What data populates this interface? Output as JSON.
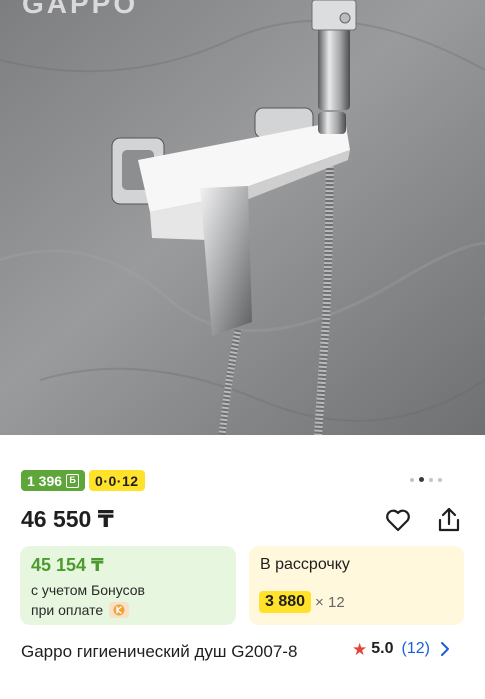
{
  "product": {
    "brand_watermark": "GAPPO",
    "bonus_badge": "1 396",
    "installment_badge": "0·0·12",
    "price": "46 550 ₸",
    "bonus_card": {
      "amount": "45 154 ₸",
      "line1": "с учетом Бонусов",
      "line2": "при оплате"
    },
    "installment_card": {
      "title": "В рассрочку",
      "amount": "3 880",
      "multiplier": "× 12"
    },
    "title": "Gappo гигиенический душ G2007-8",
    "rating": {
      "score": "5.0",
      "count": "(12)"
    }
  },
  "gallery": {
    "total": 4,
    "active": 2
  },
  "colors": {
    "bonus_green": "#5ea63a",
    "installment_yellow": "#ffe229",
    "star_red": "#e4453a",
    "link_blue": "#1b5fd6"
  },
  "icons": [
    "heart-icon",
    "share-icon",
    "star-icon",
    "chevron-right-icon",
    "kaspi-icon"
  ]
}
